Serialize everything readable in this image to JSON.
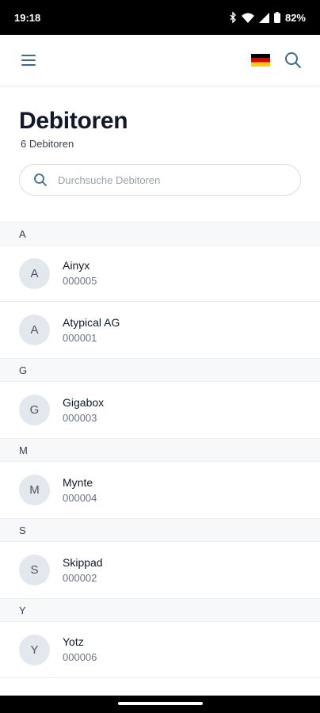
{
  "status_bar": {
    "time": "19:18",
    "battery": "82%"
  },
  "header": {
    "menu_icon": "hamburger-menu-icon",
    "flag_icon": "germany-flag-icon",
    "search_icon": "search-icon"
  },
  "page": {
    "title": "Debitoren",
    "subtitle": "6 Debitoren"
  },
  "search": {
    "placeholder": "Durchsuche Debitoren",
    "value": ""
  },
  "sections": [
    {
      "letter": "A",
      "items": [
        {
          "initial": "A",
          "name": "Ainyx",
          "number": "000005"
        },
        {
          "initial": "A",
          "name": "Atypical AG",
          "number": "000001"
        }
      ]
    },
    {
      "letter": "G",
      "items": [
        {
          "initial": "G",
          "name": "Gigabox",
          "number": "000003"
        }
      ]
    },
    {
      "letter": "M",
      "items": [
        {
          "initial": "M",
          "name": "Mynte",
          "number": "000004"
        }
      ]
    },
    {
      "letter": "S",
      "items": [
        {
          "initial": "S",
          "name": "Skippad",
          "number": "000002"
        }
      ]
    },
    {
      "letter": "Y",
      "items": [
        {
          "initial": "Y",
          "name": "Yotz",
          "number": "000006"
        }
      ]
    }
  ],
  "colors": {
    "accent": "#3d6b8c",
    "avatar_bg": "#e3e7ee",
    "section_bg": "#f7f8fa"
  }
}
